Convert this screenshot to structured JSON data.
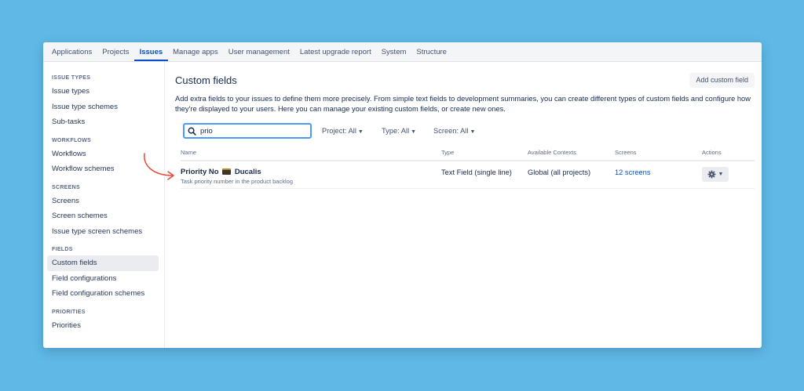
{
  "topnav": {
    "tabs": [
      {
        "label": "Applications"
      },
      {
        "label": "Projects"
      },
      {
        "label": "Issues",
        "active": true
      },
      {
        "label": "Manage apps"
      },
      {
        "label": "User management"
      },
      {
        "label": "Latest upgrade report"
      },
      {
        "label": "System"
      },
      {
        "label": "Structure"
      }
    ]
  },
  "sidebar": {
    "sections": [
      {
        "title": "ISSUE TYPES",
        "items": [
          "Issue types",
          "Issue type schemes",
          "Sub-tasks"
        ]
      },
      {
        "title": "WORKFLOWS",
        "items": [
          "Workflows",
          "Workflow schemes"
        ]
      },
      {
        "title": "SCREENS",
        "items": [
          "Screens",
          "Screen schemes",
          "Issue type screen schemes"
        ]
      },
      {
        "title": "FIELDS",
        "items": [
          "Custom fields",
          "Field configurations",
          "Field configuration schemes"
        ]
      },
      {
        "title": "PRIORITIES",
        "items": [
          "Priorities"
        ]
      }
    ],
    "active_item": "Custom fields"
  },
  "main": {
    "title": "Custom fields",
    "add_button": "Add custom field",
    "description": "Add extra fields to your issues to define them more precisely. From simple text fields to development summaries, you can create different types of custom fields and configure how they're displayed to your users. Here you can manage your existing custom fields, or create new ones.",
    "search": {
      "value": "prio"
    },
    "filters": {
      "project": "Project: All",
      "type": "Type: All",
      "screen": "Screen: All"
    },
    "table": {
      "headers": {
        "name": "Name",
        "type": "Type",
        "contexts": "Available Contexts",
        "screens": "Screens",
        "actions": "Actions"
      },
      "rows": [
        {
          "name_prefix": "Priority No",
          "name_suffix": "Ducalis",
          "description": "Task priority number in the product backlog",
          "type": "Text Field (single line)",
          "contexts": "Global (all projects)",
          "screens": "12 screens"
        }
      ]
    }
  },
  "colors": {
    "background": "#5fb8e6",
    "accent": "#0052cc",
    "focus_border": "#4c9aff",
    "annotation_arrow": "#e5493a"
  },
  "icons": {
    "search": "search-icon",
    "gear": "gear-icon",
    "chevron": "chevron-down-icon",
    "arrow": "annotation-arrow"
  }
}
